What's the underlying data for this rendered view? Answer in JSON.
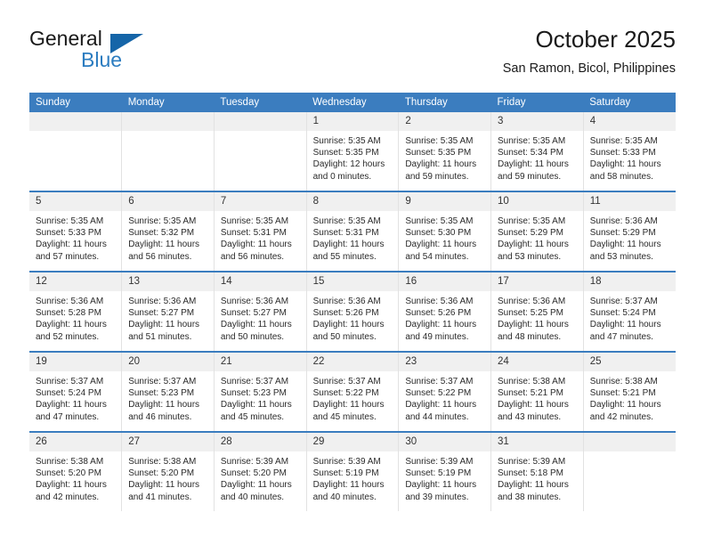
{
  "brand": {
    "name_top": "General",
    "name_bottom": "Blue",
    "accent_color": "#2b7cc0",
    "triangle_color": "#1565a8",
    "triangle_icon": "triangle-icon"
  },
  "header": {
    "title": "October 2025",
    "subtitle": "San Ramon, Bicol, Philippines"
  },
  "theme": {
    "header_bg": "#3b7dbf",
    "header_text": "#ffffff",
    "daynum_bg": "#f0f0f0",
    "cell_bg": "#ffffff",
    "divider": "#e2e2e2"
  },
  "calendar": {
    "weekday_headers": [
      "Sunday",
      "Monday",
      "Tuesday",
      "Wednesday",
      "Thursday",
      "Friday",
      "Saturday"
    ],
    "weeks": [
      [
        {
          "day": "",
          "sunrise": "",
          "sunset": "",
          "daylight": "",
          "empty": true
        },
        {
          "day": "",
          "sunrise": "",
          "sunset": "",
          "daylight": "",
          "empty": true
        },
        {
          "day": "",
          "sunrise": "",
          "sunset": "",
          "daylight": "",
          "empty": true
        },
        {
          "day": "1",
          "sunrise": "Sunrise: 5:35 AM",
          "sunset": "Sunset: 5:35 PM",
          "daylight": "Daylight: 12 hours and 0 minutes.",
          "empty": false
        },
        {
          "day": "2",
          "sunrise": "Sunrise: 5:35 AM",
          "sunset": "Sunset: 5:35 PM",
          "daylight": "Daylight: 11 hours and 59 minutes.",
          "empty": false
        },
        {
          "day": "3",
          "sunrise": "Sunrise: 5:35 AM",
          "sunset": "Sunset: 5:34 PM",
          "daylight": "Daylight: 11 hours and 59 minutes.",
          "empty": false
        },
        {
          "day": "4",
          "sunrise": "Sunrise: 5:35 AM",
          "sunset": "Sunset: 5:33 PM",
          "daylight": "Daylight: 11 hours and 58 minutes.",
          "empty": false
        }
      ],
      [
        {
          "day": "5",
          "sunrise": "Sunrise: 5:35 AM",
          "sunset": "Sunset: 5:33 PM",
          "daylight": "Daylight: 11 hours and 57 minutes.",
          "empty": false
        },
        {
          "day": "6",
          "sunrise": "Sunrise: 5:35 AM",
          "sunset": "Sunset: 5:32 PM",
          "daylight": "Daylight: 11 hours and 56 minutes.",
          "empty": false
        },
        {
          "day": "7",
          "sunrise": "Sunrise: 5:35 AM",
          "sunset": "Sunset: 5:31 PM",
          "daylight": "Daylight: 11 hours and 56 minutes.",
          "empty": false
        },
        {
          "day": "8",
          "sunrise": "Sunrise: 5:35 AM",
          "sunset": "Sunset: 5:31 PM",
          "daylight": "Daylight: 11 hours and 55 minutes.",
          "empty": false
        },
        {
          "day": "9",
          "sunrise": "Sunrise: 5:35 AM",
          "sunset": "Sunset: 5:30 PM",
          "daylight": "Daylight: 11 hours and 54 minutes.",
          "empty": false
        },
        {
          "day": "10",
          "sunrise": "Sunrise: 5:35 AM",
          "sunset": "Sunset: 5:29 PM",
          "daylight": "Daylight: 11 hours and 53 minutes.",
          "empty": false
        },
        {
          "day": "11",
          "sunrise": "Sunrise: 5:36 AM",
          "sunset": "Sunset: 5:29 PM",
          "daylight": "Daylight: 11 hours and 53 minutes.",
          "empty": false
        }
      ],
      [
        {
          "day": "12",
          "sunrise": "Sunrise: 5:36 AM",
          "sunset": "Sunset: 5:28 PM",
          "daylight": "Daylight: 11 hours and 52 minutes.",
          "empty": false
        },
        {
          "day": "13",
          "sunrise": "Sunrise: 5:36 AM",
          "sunset": "Sunset: 5:27 PM",
          "daylight": "Daylight: 11 hours and 51 minutes.",
          "empty": false
        },
        {
          "day": "14",
          "sunrise": "Sunrise: 5:36 AM",
          "sunset": "Sunset: 5:27 PM",
          "daylight": "Daylight: 11 hours and 50 minutes.",
          "empty": false
        },
        {
          "day": "15",
          "sunrise": "Sunrise: 5:36 AM",
          "sunset": "Sunset: 5:26 PM",
          "daylight": "Daylight: 11 hours and 50 minutes.",
          "empty": false
        },
        {
          "day": "16",
          "sunrise": "Sunrise: 5:36 AM",
          "sunset": "Sunset: 5:26 PM",
          "daylight": "Daylight: 11 hours and 49 minutes.",
          "empty": false
        },
        {
          "day": "17",
          "sunrise": "Sunrise: 5:36 AM",
          "sunset": "Sunset: 5:25 PM",
          "daylight": "Daylight: 11 hours and 48 minutes.",
          "empty": false
        },
        {
          "day": "18",
          "sunrise": "Sunrise: 5:37 AM",
          "sunset": "Sunset: 5:24 PM",
          "daylight": "Daylight: 11 hours and 47 minutes.",
          "empty": false
        }
      ],
      [
        {
          "day": "19",
          "sunrise": "Sunrise: 5:37 AM",
          "sunset": "Sunset: 5:24 PM",
          "daylight": "Daylight: 11 hours and 47 minutes.",
          "empty": false
        },
        {
          "day": "20",
          "sunrise": "Sunrise: 5:37 AM",
          "sunset": "Sunset: 5:23 PM",
          "daylight": "Daylight: 11 hours and 46 minutes.",
          "empty": false
        },
        {
          "day": "21",
          "sunrise": "Sunrise: 5:37 AM",
          "sunset": "Sunset: 5:23 PM",
          "daylight": "Daylight: 11 hours and 45 minutes.",
          "empty": false
        },
        {
          "day": "22",
          "sunrise": "Sunrise: 5:37 AM",
          "sunset": "Sunset: 5:22 PM",
          "daylight": "Daylight: 11 hours and 45 minutes.",
          "empty": false
        },
        {
          "day": "23",
          "sunrise": "Sunrise: 5:37 AM",
          "sunset": "Sunset: 5:22 PM",
          "daylight": "Daylight: 11 hours and 44 minutes.",
          "empty": false
        },
        {
          "day": "24",
          "sunrise": "Sunrise: 5:38 AM",
          "sunset": "Sunset: 5:21 PM",
          "daylight": "Daylight: 11 hours and 43 minutes.",
          "empty": false
        },
        {
          "day": "25",
          "sunrise": "Sunrise: 5:38 AM",
          "sunset": "Sunset: 5:21 PM",
          "daylight": "Daylight: 11 hours and 42 minutes.",
          "empty": false
        }
      ],
      [
        {
          "day": "26",
          "sunrise": "Sunrise: 5:38 AM",
          "sunset": "Sunset: 5:20 PM",
          "daylight": "Daylight: 11 hours and 42 minutes.",
          "empty": false
        },
        {
          "day": "27",
          "sunrise": "Sunrise: 5:38 AM",
          "sunset": "Sunset: 5:20 PM",
          "daylight": "Daylight: 11 hours and 41 minutes.",
          "empty": false
        },
        {
          "day": "28",
          "sunrise": "Sunrise: 5:39 AM",
          "sunset": "Sunset: 5:20 PM",
          "daylight": "Daylight: 11 hours and 40 minutes.",
          "empty": false
        },
        {
          "day": "29",
          "sunrise": "Sunrise: 5:39 AM",
          "sunset": "Sunset: 5:19 PM",
          "daylight": "Daylight: 11 hours and 40 minutes.",
          "empty": false
        },
        {
          "day": "30",
          "sunrise": "Sunrise: 5:39 AM",
          "sunset": "Sunset: 5:19 PM",
          "daylight": "Daylight: 11 hours and 39 minutes.",
          "empty": false
        },
        {
          "day": "31",
          "sunrise": "Sunrise: 5:39 AM",
          "sunset": "Sunset: 5:18 PM",
          "daylight": "Daylight: 11 hours and 38 minutes.",
          "empty": false
        },
        {
          "day": "",
          "sunrise": "",
          "sunset": "",
          "daylight": "",
          "empty": true
        }
      ]
    ]
  }
}
